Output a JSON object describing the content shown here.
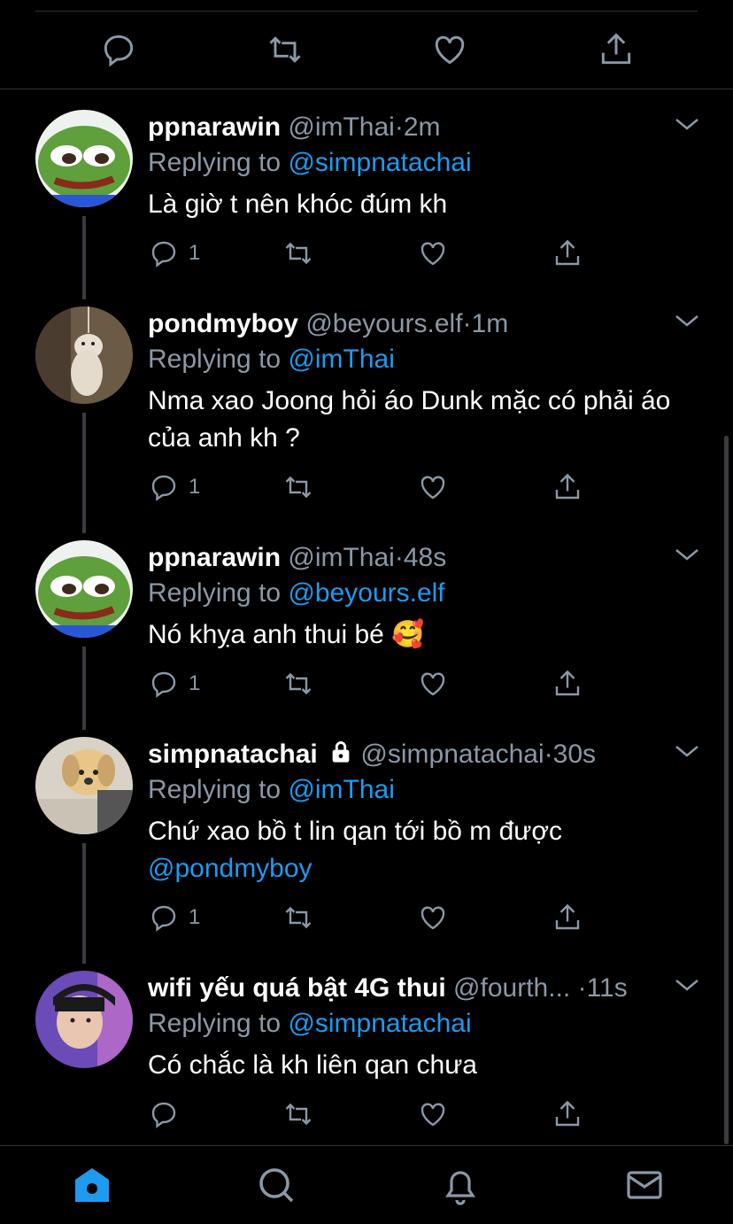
{
  "top_actions": [
    "reply-icon",
    "retweet-icon",
    "like-icon",
    "share-icon"
  ],
  "tweets": [
    {
      "name": "ppnarawin",
      "handle": "@imThai",
      "time": "2m",
      "replying_prefix": "Replying to ",
      "replying_to": "@simpnatachai",
      "text": "Là giờ t nên khóc đúm kh",
      "reply_count": "1",
      "avatar": "pepe-frog"
    },
    {
      "name": "pondmyboy",
      "handle": "@beyours.elf",
      "time": "1m",
      "replying_prefix": "Replying to ",
      "replying_to": "@imThai",
      "text": "Nma xao Joong hỏi áo Dunk mặc có phải áo của anh kh ?",
      "reply_count": "1",
      "avatar": "hanging-dog"
    },
    {
      "name": "ppnarawin",
      "handle": "@imThai",
      "time": "48s",
      "replying_prefix": "Replying to ",
      "replying_to": "@beyours.elf",
      "text": "Nó khỵa anh thui bé 🥰",
      "reply_count": "1",
      "avatar": "pepe-frog"
    },
    {
      "name": "simpnatachai",
      "handle": "@simpnatachai",
      "time": "30s",
      "replying_prefix": "Replying to ",
      "replying_to": "@imThai",
      "text": "Chứ xao bồ t lin qan tới bồ m được",
      "text_mention": "@pondmyboy",
      "reply_count": "1",
      "avatar": "puppy",
      "protected": true
    },
    {
      "name": "wifi yếu quá bật 4G thui",
      "handle": "@fourth...",
      "time": "11s",
      "replying_prefix": "Replying to ",
      "replying_to": "@simpnatachai",
      "text": "Có chắc là kh liên qan chưa",
      "reply_count": "",
      "avatar": "person-photo"
    }
  ],
  "tabs": [
    "home-icon",
    "search-icon",
    "notifications-icon",
    "messages-icon"
  ],
  "colors": {
    "accent": "#1d9bf0",
    "muted": "#8b98a5",
    "bg": "#000000",
    "divider": "#2f3336"
  }
}
